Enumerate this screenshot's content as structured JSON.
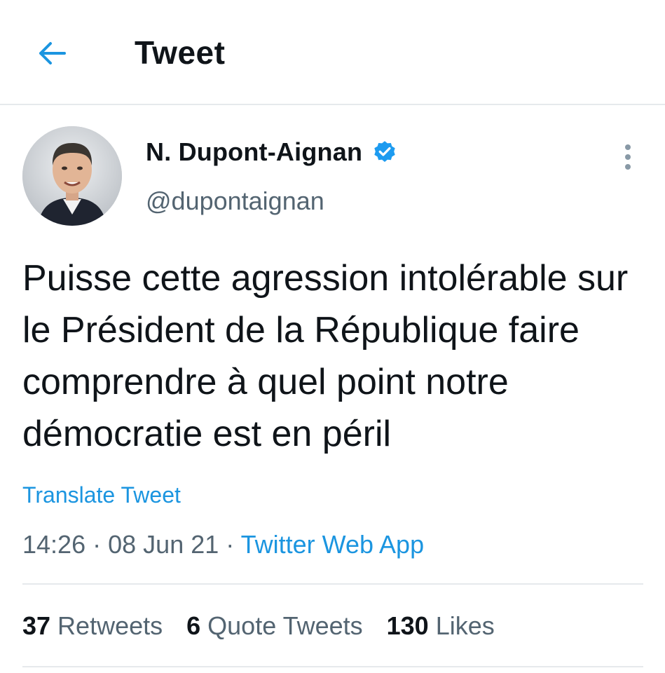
{
  "header": {
    "back_icon": "arrow-left-icon",
    "title": "Tweet"
  },
  "colors": {
    "accent": "#1b95e0",
    "text_primary": "#0f1419",
    "text_secondary": "#536471",
    "divider": "#e6e9ec"
  },
  "tweet": {
    "author": {
      "display_name": "N. Dupont-Aignan",
      "verified_icon": "verified-badge-icon",
      "handle": "@dupontaignan",
      "avatar_icon": "avatar-photo"
    },
    "more_icon": "more-vertical-icon",
    "text": "Puisse cette agression intolérable sur le Président de la République faire comprendre à quel point notre démocratie est en péril",
    "translate_label": "Translate Tweet",
    "time": "14:26",
    "date": "08 Jun 21",
    "separator": "·",
    "source": "Twitter Web App"
  },
  "stats": [
    {
      "count": "37",
      "label": "Retweets"
    },
    {
      "count": "6",
      "label": "Quote Tweets"
    },
    {
      "count": "130",
      "label": "Likes"
    }
  ]
}
